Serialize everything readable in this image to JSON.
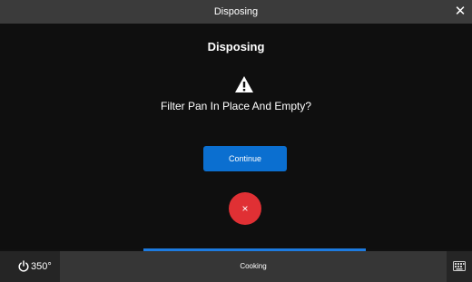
{
  "window": {
    "title": "Disposing",
    "close_glyph": "✕"
  },
  "dialog": {
    "heading": "Disposing",
    "warning_icon": "warning-triangle-icon",
    "prompt": "Filter Pan In Place And Empty?",
    "continue_label": "Continue",
    "cancel_glyph": "×"
  },
  "bottom_bar": {
    "power_icon": "power-icon",
    "temperature": "350°",
    "status": "Cooking",
    "keyboard_icon": "keyboard-icon"
  },
  "colors": {
    "title_bar": "#3b3b3b",
    "background": "#0f0f0f",
    "continue_button": "#0b6fd0",
    "cancel_button": "#e03034",
    "progress": "#1d7be0"
  }
}
